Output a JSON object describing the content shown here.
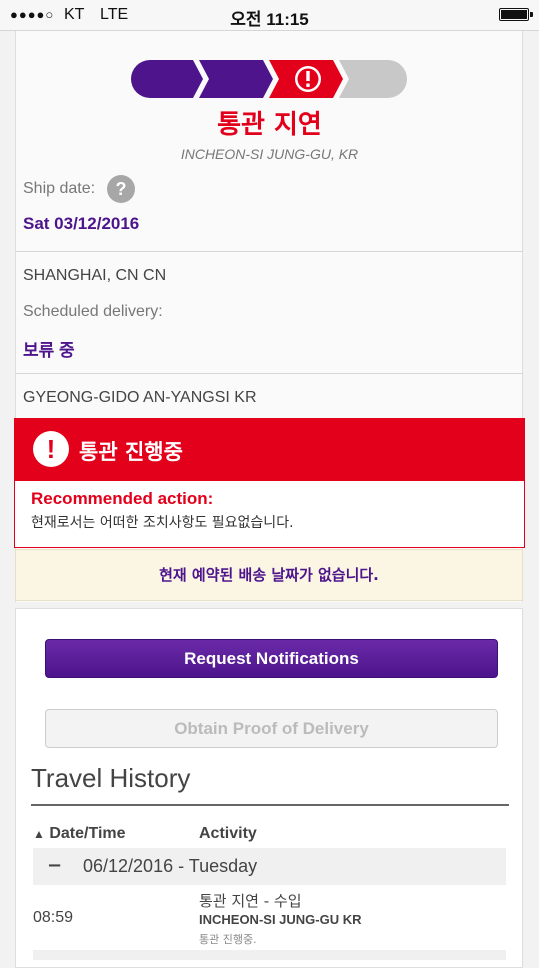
{
  "status_bar": {
    "signal": "●●●●○",
    "carrier": "KT",
    "network": "LTE",
    "time": "오전 11:15"
  },
  "shipment": {
    "status_title": "통관 지연",
    "status_location": "INCHEON-SI JUNG-GU, KR",
    "ship_date_label": "Ship date:",
    "ship_date_help": "?",
    "ship_date": "Sat 03/12/2016",
    "origin": "SHANGHAI, CN CN",
    "scheduled_label": "Scheduled delivery:",
    "scheduled_value": "보류 중",
    "destination": "GYEONG-GIDO AN-YANGSI KR"
  },
  "progress": {
    "steps_total": 4,
    "current_step": 3,
    "colors": {
      "done": "#4d148c",
      "alert": "#e3001b",
      "pending": "#c8c8c8"
    }
  },
  "alert": {
    "icon": "!",
    "title": "통관 진행중",
    "recommended_label": "Recommended action:",
    "message": "현재로서는 어떠한 조치사항도 필요없습니다."
  },
  "notice": "현재 예약된 배송 날짜가 없습니다.",
  "buttons": {
    "request_notifications": "Request Notifications",
    "obtain_proof": "Obtain Proof of Delivery"
  },
  "travel_history": {
    "title": "Travel History",
    "sort_icon": "▲",
    "col_date": "Date/Time",
    "col_activity": "Activity",
    "day": {
      "toggle": "−",
      "label": "06/12/2016 - Tuesday"
    },
    "events": [
      {
        "time": "08:59",
        "activity": "통관 지연 - 수입",
        "location": "INCHEON-SI JUNG-GU KR",
        "note": "통관 진행중."
      }
    ]
  },
  "colors": {
    "brand_purple": "#4d148c",
    "alert_red": "#e3001b",
    "notice_bg": "#fbf6e3"
  }
}
